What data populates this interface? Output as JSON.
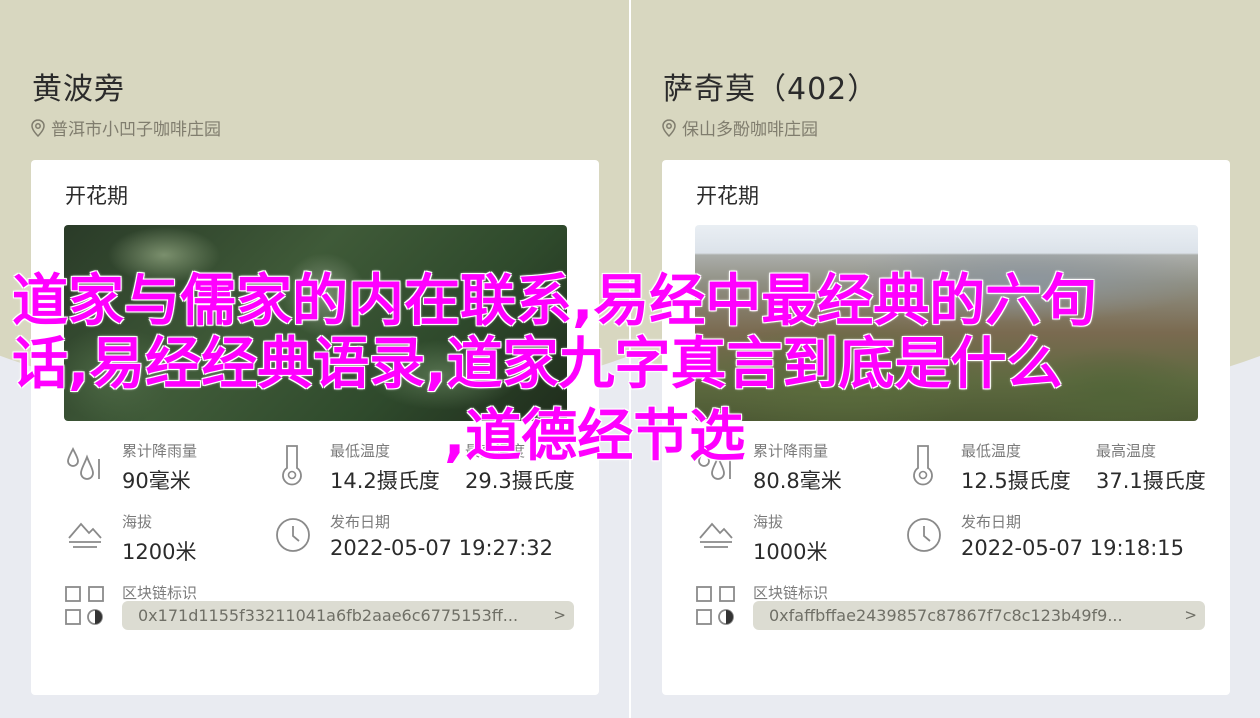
{
  "cards": [
    {
      "title": "黄波旁",
      "location": "普洱市小凹子咖啡庄园",
      "section_title": "开花期",
      "rainfall": {
        "label": "累计降雨量",
        "value": "90毫米"
      },
      "min_temp": {
        "label": "最低温度",
        "value": "14.2摄氏度"
      },
      "max_temp": {
        "label": "最高温度",
        "value": "29.3摄氏度"
      },
      "altitude": {
        "label": "海拔",
        "value": "1200米"
      },
      "publish_date": {
        "label": "发布日期",
        "value": "2022-05-07 19:27:32"
      },
      "chain_id": {
        "label": "区块链标识",
        "value": "0x171d1155f33211041a6fb2aae6c6775153ff..."
      }
    },
    {
      "title": "萨奇莫（402）",
      "location": "保山多酚咖啡庄园",
      "section_title": "开花期",
      "rainfall": {
        "label": "累计降雨量",
        "value": "80.8毫米"
      },
      "min_temp": {
        "label": "最低温度",
        "value": "12.5摄氏度"
      },
      "max_temp": {
        "label": "最高温度",
        "value": "37.1摄氏度"
      },
      "altitude": {
        "label": "海拔",
        "value": "1000米"
      },
      "publish_date": {
        "label": "发布日期",
        "value": "2022-05-07 19:18:15"
      },
      "chain_id": {
        "label": "区块链标识",
        "value": "0xfaffbffae2439857c87867f7c8c123b49f9..."
      }
    }
  ],
  "overlay": {
    "line1": "道家与儒家的内在联系,易经中最经典的六句",
    "line2": "话,易经经典语录,道家九字真言到底是什么",
    "line3": ",道德经节选"
  },
  "icons": [
    "location-pin-icon",
    "raindrops-icon",
    "thermometer-icon",
    "mountain-icon",
    "clock-icon",
    "blockchain-icon",
    "chevron-right-icon"
  ],
  "colors": {
    "overlay_text": "#ff00ff",
    "header_bg": "#d8d7c0",
    "pill_bg": "#dcdcd2"
  }
}
